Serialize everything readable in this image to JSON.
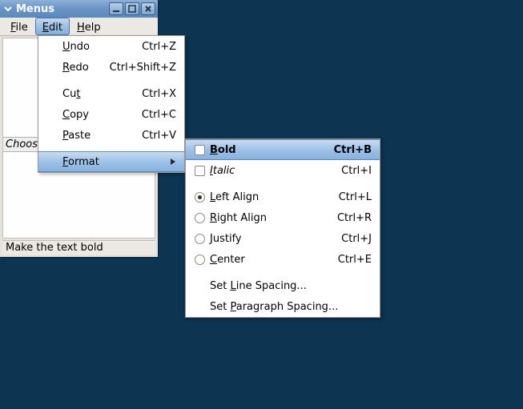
{
  "window": {
    "title": "Menus"
  },
  "menubar": {
    "file": "File",
    "edit": "Edit",
    "help": "Help"
  },
  "client": {
    "choose_hint": "Choos"
  },
  "statusbar": {
    "text": "Make the text bold"
  },
  "edit_menu": {
    "undo": {
      "label": "Undo",
      "accel": "Ctrl+Z"
    },
    "redo": {
      "label": "Redo",
      "accel": "Ctrl+Shift+Z"
    },
    "cut": {
      "label": "Cut",
      "accel": "Ctrl+X"
    },
    "copy": {
      "label": "Copy",
      "accel": "Ctrl+C"
    },
    "paste": {
      "label": "Paste",
      "accel": "Ctrl+V"
    },
    "format": {
      "label": "Format"
    }
  },
  "format_menu": {
    "bold": {
      "label": "Bold",
      "accel": "Ctrl+B"
    },
    "italic": {
      "label": "Italic",
      "accel": "Ctrl+I"
    },
    "left": {
      "label": "Left Align",
      "accel": "Ctrl+L"
    },
    "right": {
      "label": "Right Align",
      "accel": "Ctrl+R"
    },
    "justify": {
      "label": "Justify",
      "accel": "Ctrl+J"
    },
    "center": {
      "label": "Center",
      "accel": "Ctrl+E"
    },
    "line_spacing": {
      "label": "Set Line Spacing..."
    },
    "para_spacing": {
      "label": "Set Paragraph Spacing..."
    }
  }
}
